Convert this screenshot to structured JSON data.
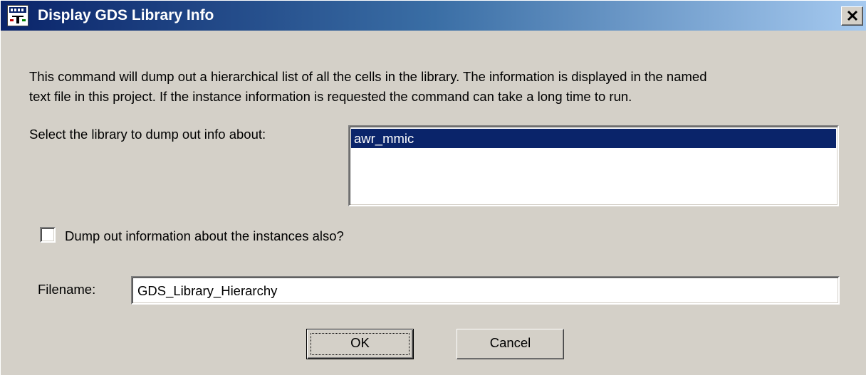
{
  "window": {
    "title": "Display GDS Library Info",
    "app_icon": "gds-app-icon",
    "close_icon": "close-icon"
  },
  "description": {
    "line1": "This command will dump out a hierarchical list of all the cells in the library.  The information is displayed in the named",
    "line2": "text file in this project.  If the instance information is requested the command can take a long time to run."
  },
  "library": {
    "label": "Select the library to dump out info about:",
    "items": [
      "awr_mmic"
    ],
    "selected": "awr_mmic"
  },
  "instances_option": {
    "label": "Dump out information about the instances also?",
    "checked": false
  },
  "filename": {
    "label": "Filename:",
    "value": "GDS_Library_Hierarchy"
  },
  "buttons": {
    "ok": "OK",
    "cancel": "Cancel"
  },
  "colors": {
    "face": "#d4d0c8",
    "titlebar_start": "#0a246a",
    "titlebar_end": "#a6caf0",
    "selection": "#0a246a"
  }
}
